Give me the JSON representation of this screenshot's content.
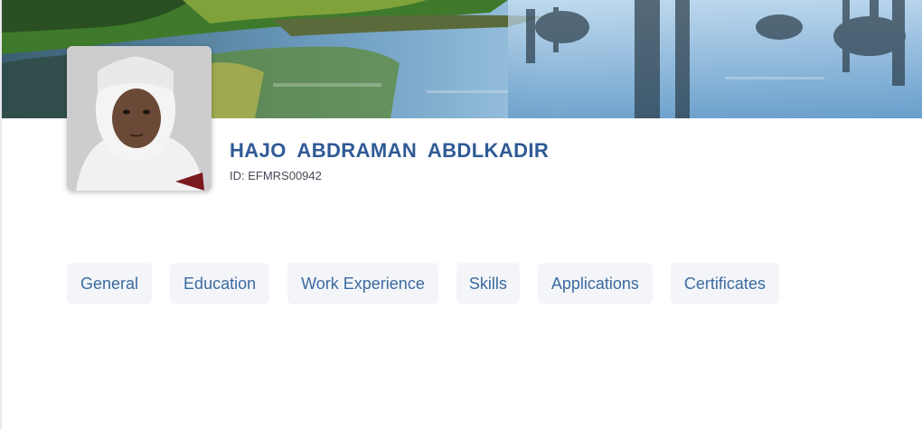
{
  "profile": {
    "name": "HAJO ABDRAMAN ABDLKADIR",
    "id_text": "ID: EFMRS00942"
  },
  "tabs": [
    {
      "label": "General"
    },
    {
      "label": "Education"
    },
    {
      "label": "Work Experience"
    },
    {
      "label": "Skills"
    },
    {
      "label": "Applications"
    },
    {
      "label": "Certificates"
    }
  ],
  "colors": {
    "name": "#2f5a96",
    "tab_text": "#3b6aa0",
    "tab_bg": "#f3f5f9"
  }
}
